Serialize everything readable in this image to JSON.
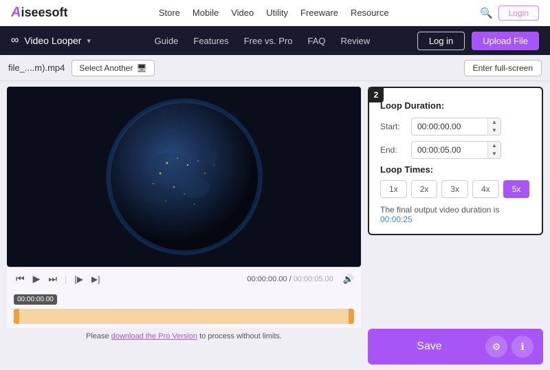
{
  "top_nav": {
    "logo_prefix": "A",
    "logo_text": "iseesoft",
    "links": [
      "Store",
      "Mobile",
      "Video",
      "Utility",
      "Freeware",
      "Resource"
    ],
    "login_label": "Login"
  },
  "second_nav": {
    "tool_name": "Video Looper",
    "links": [
      "Guide",
      "Features",
      "Free vs. Pro",
      "FAQ",
      "Review"
    ],
    "log_in_label": "Log in",
    "upload_label": "Upload File"
  },
  "toolbar": {
    "file_name": "file_....m).mp4",
    "select_another_label": "Select Another",
    "fullscreen_label": "Enter full-screen"
  },
  "video_controls": {
    "time_current": "00:00:00.00",
    "time_separator": "/",
    "time_total": "00:00:05.00",
    "timeline_start_label": "00:00:00.00"
  },
  "loop_settings": {
    "badge": "2",
    "duration_label": "Loop Duration:",
    "start_label": "Start:",
    "start_value": "00:00:00.00",
    "end_label": "End:",
    "end_value": "00:00:05.00",
    "loop_times_label": "Loop Times:",
    "loop_options": [
      "1x",
      "2x",
      "3x",
      "4x",
      "5x"
    ],
    "active_loop": "5x",
    "output_text": "The final output video duration is ",
    "output_duration": "00:00:25"
  },
  "save_bar": {
    "save_label": "Save",
    "gear_icon": "⚙",
    "info_icon": "ℹ"
  },
  "pro_notice": {
    "text_before": "Please ",
    "link_text": "download the Pro Version",
    "text_after": " to process without limits."
  }
}
